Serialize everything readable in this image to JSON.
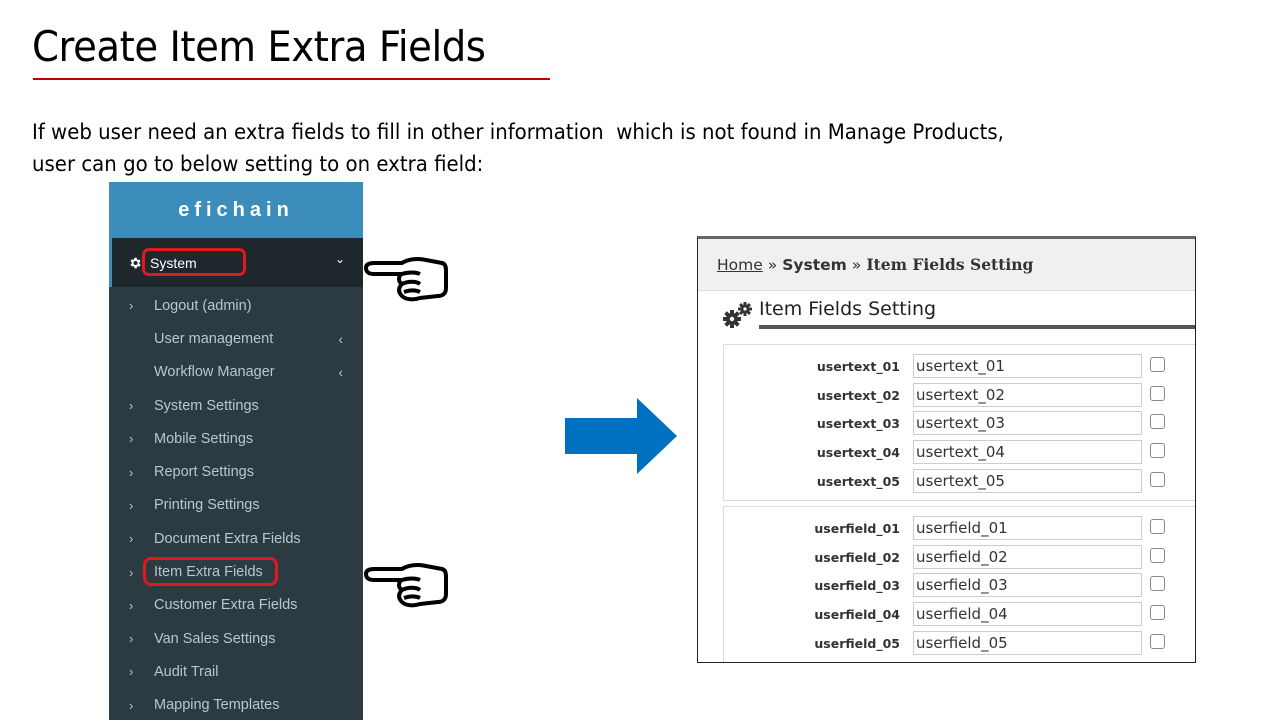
{
  "slide": {
    "title": "Create Item Extra Fields",
    "intro_line1": "If web user need an extra fields to fill in other information  which is not found in Manage Products,",
    "intro_line2": "user can go to below setting to on extra field:",
    "accent_color": "#c00000",
    "arrow_color": "#0070c0"
  },
  "sidebar": {
    "brand": "efichain",
    "brand_color": "#3c8dbc",
    "active_menu": {
      "label": "System",
      "icon": "gear-icon",
      "chevron": "chevron-down-icon",
      "highlighted": true
    },
    "items": [
      {
        "label": "Logout (admin)",
        "prefix": "›",
        "suffix": ""
      },
      {
        "label": "User management",
        "prefix": "",
        "suffix": "‹"
      },
      {
        "label": "Workflow Manager",
        "prefix": "",
        "suffix": "‹"
      },
      {
        "label": "System Settings",
        "prefix": "›",
        "suffix": ""
      },
      {
        "label": "Mobile Settings",
        "prefix": "›",
        "suffix": ""
      },
      {
        "label": "Report Settings",
        "prefix": "›",
        "suffix": ""
      },
      {
        "label": "Printing Settings",
        "prefix": "›",
        "suffix": ""
      },
      {
        "label": "Document Extra Fields",
        "prefix": "›",
        "suffix": ""
      },
      {
        "label": "Item Extra Fields",
        "prefix": "›",
        "suffix": "",
        "highlighted": true
      },
      {
        "label": "Customer Extra Fields",
        "prefix": "›",
        "suffix": ""
      },
      {
        "label": "Van Sales Settings",
        "prefix": "›",
        "suffix": ""
      },
      {
        "label": "Audit Trail",
        "prefix": "›",
        "suffix": ""
      },
      {
        "label": "Mapping Templates",
        "prefix": "›",
        "suffix": ""
      }
    ]
  },
  "panel": {
    "breadcrumb": {
      "home": "Home",
      "sep": "»",
      "section": "System",
      "current": "Item Fields Setting"
    },
    "page_title": "Item Fields Setting",
    "usertext": [
      {
        "label": "usertext_01",
        "value": "usertext_01",
        "checked": false
      },
      {
        "label": "usertext_02",
        "value": "usertext_02",
        "checked": false
      },
      {
        "label": "usertext_03",
        "value": "usertext_03",
        "checked": false
      },
      {
        "label": "usertext_04",
        "value": "usertext_04",
        "checked": false
      },
      {
        "label": "usertext_05",
        "value": "usertext_05",
        "checked": false
      }
    ],
    "userfield": [
      {
        "label": "userfield_01",
        "value": "userfield_01",
        "checked": false
      },
      {
        "label": "userfield_02",
        "value": "userfield_02",
        "checked": false
      },
      {
        "label": "userfield_03",
        "value": "userfield_03",
        "checked": false
      },
      {
        "label": "userfield_04",
        "value": "userfield_04",
        "checked": false
      },
      {
        "label": "userfield_05",
        "value": "userfield_05",
        "checked": false
      }
    ]
  }
}
